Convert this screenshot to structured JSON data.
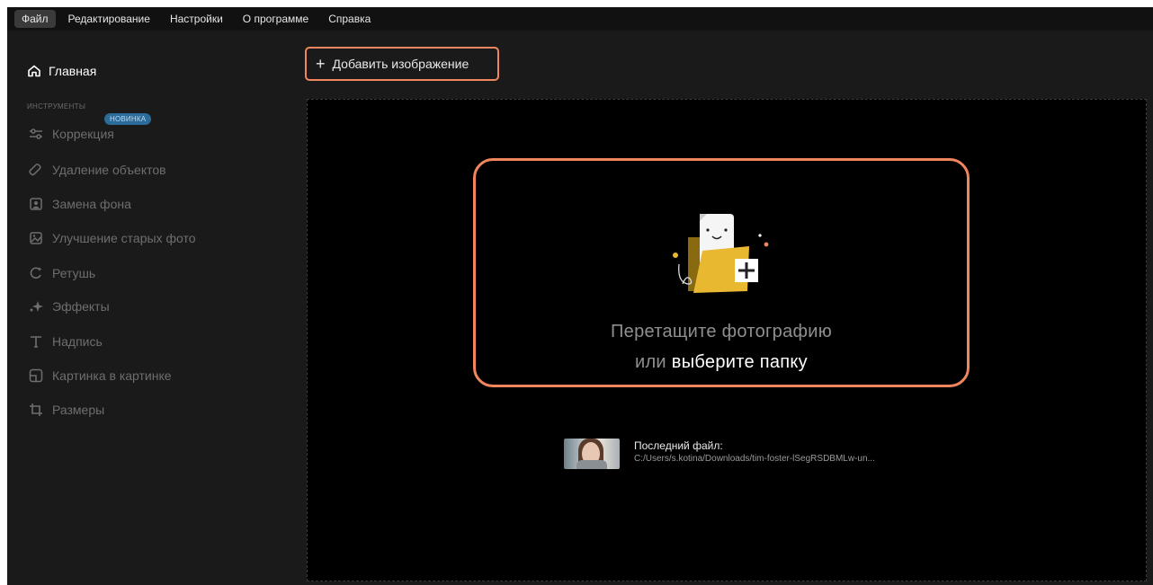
{
  "menu": {
    "items": [
      {
        "label": "Файл",
        "active": true
      },
      {
        "label": "Редактирование",
        "active": false
      },
      {
        "label": "Настройки",
        "active": false
      },
      {
        "label": "О программе",
        "active": false
      },
      {
        "label": "Справка",
        "active": false
      }
    ]
  },
  "sidebar": {
    "home": {
      "label": "Главная",
      "icon": "home-icon"
    },
    "section_caption": "ИНСТРУМЕНТЫ",
    "new_badge": "НОВИНКА",
    "items": [
      {
        "label": "Коррекция",
        "icon": "sliders-icon"
      },
      {
        "label": "Удаление объектов",
        "icon": "eraser-icon"
      },
      {
        "label": "Замена фона",
        "icon": "portrait-icon"
      },
      {
        "label": "Улучшение старых фото",
        "icon": "photo-enhance-icon"
      },
      {
        "label": "Ретушь",
        "icon": "retouch-icon"
      },
      {
        "label": "Эффекты",
        "icon": "sparkle-icon"
      },
      {
        "label": "Надпись",
        "icon": "text-icon"
      },
      {
        "label": "Картинка в картинке",
        "icon": "picture-in-picture-icon"
      },
      {
        "label": "Размеры",
        "icon": "crop-icon"
      }
    ]
  },
  "toolbar": {
    "add_image_label": "Добавить изображение"
  },
  "dropzone": {
    "line1": "Перетащите фотографию",
    "line2_prefix": "или",
    "line2_link": "выберите папку"
  },
  "last_file": {
    "title": "Последний файл:",
    "path": "C:/Users/s.kotina/Downloads/tim-foster-lSegRSDBMLw-un..."
  },
  "colors": {
    "accent": "#f0865e",
    "background": "#1a1a1a",
    "canvas": "#000000",
    "badge": "#2b6b9a",
    "folder": "#e8b830"
  }
}
